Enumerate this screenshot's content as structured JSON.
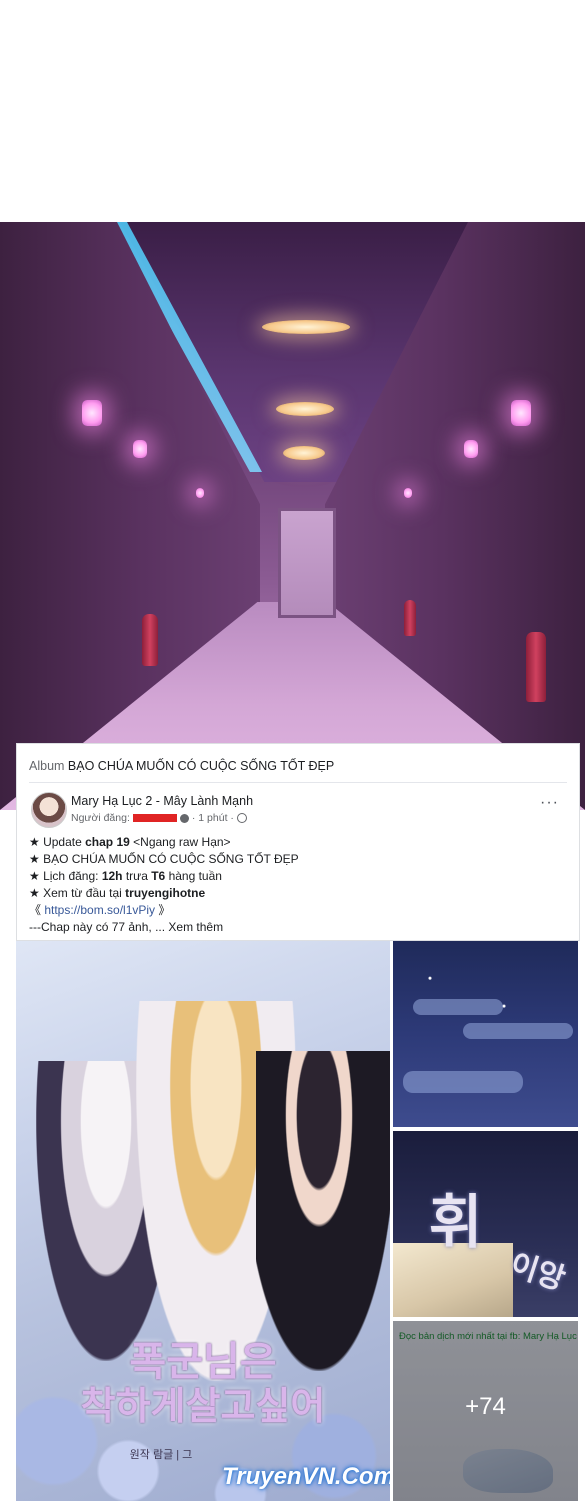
{
  "card": {
    "album_label": "Album",
    "album_title": "BẠO CHÚA MUỐN CÓ CUỘC SỐNG TỐT ĐẸP",
    "poster_name": "Mary Hạ Lục 2 - Mây Lành Mạnh",
    "poster_role": "Người đăng:",
    "post_time": "· 1 phút ·",
    "more_icon": "···",
    "lines": {
      "l1_prefix": "★ Update ",
      "l1_bold": "chap 19",
      "l1_suffix": " <Ngang raw Hạn>",
      "l2": "★ BẠO CHÚA MUỐN CÓ CUỘC SỐNG TỐT ĐẸP",
      "l3_prefix": "★ Lịch đăng: ",
      "l3_bold1": "12h",
      "l3_mid": " trưa ",
      "l3_bold2": "T6",
      "l3_suffix": " hàng tuần",
      "l4_prefix": "★ Xem từ đầu tại ",
      "l4_bold": "truyengihotne",
      "l5_open": "《 ",
      "l5_link": "https://bom.so/l1vPiy",
      "l5_close": " 》",
      "l6": "---Chap này có 77 ảnh, ... Xem thêm"
    }
  },
  "cover": {
    "kor_line1": "폭군님은",
    "kor_line2": "착하게살고싶어",
    "credit": "원작 람글 | 그",
    "watermark": "TruyenVN.Com"
  },
  "thumbs": {
    "sfx_big": "휘",
    "sfx_small": "이앙",
    "note": "Đọc bản dịch mới nhất tại fb: Mary Hạ Lục",
    "more_count": "+74"
  },
  "colors": {
    "accent_link": "#385898",
    "redaction": "#e02424",
    "corridor_purple": "#8a5a92"
  }
}
